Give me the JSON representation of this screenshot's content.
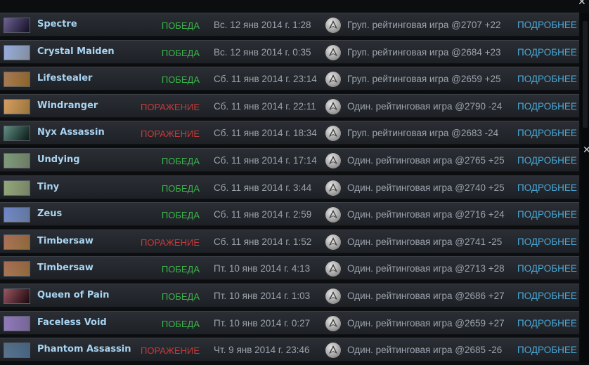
{
  "matches": [
    {
      "hero": "Spectre",
      "hero_colors": [
        "#3b2e6e",
        "#1d1638"
      ],
      "result": "ПОБЕДА",
      "result_type": "win",
      "date": "Вс. 12 янв 2014 г. 1:28",
      "mode": "Груп. рейтинговая игра @2707 +22",
      "details": "ПОДРОБНЕЕ"
    },
    {
      "hero": "Crystal Maiden",
      "hero_colors": [
        "#6f8fd6",
        "#c9d8ee"
      ],
      "result": "ПОБЕДА",
      "result_type": "win",
      "date": "Вс. 12 янв 2014 г. 0:35",
      "mode": "Груп. рейтинговая игра @2684 +23",
      "details": "ПОДРОБНЕЕ"
    },
    {
      "hero": "Lifestealer",
      "hero_colors": [
        "#8a4a1c",
        "#d39a3c"
      ],
      "result": "ПОБЕДА",
      "result_type": "win",
      "date": "Сб. 11 янв 2014 г. 23:14",
      "mode": "Груп. рейтинговая игра @2659 +25",
      "details": "ПОДРОБНЕЕ"
    },
    {
      "hero": "Windranger",
      "hero_colors": [
        "#c97a2c",
        "#e8b45c"
      ],
      "result": "ПОРАЖЕНИЕ",
      "result_type": "loss",
      "date": "Сб. 11 янв 2014 г. 22:11",
      "mode": "Один. рейтинговая игра @2790 -24",
      "details": "ПОДРОБНЕЕ"
    },
    {
      "hero": "Nyx Assassin",
      "hero_colors": [
        "#2b6a5a",
        "#0e2622"
      ],
      "result": "ПОРАЖЕНИЕ",
      "result_type": "loss",
      "date": "Сб. 11 янв 2014 г. 18:34",
      "mode": "Груп. рейтинговая игра @2683 -24",
      "details": "ПОДРОБНЕЕ"
    },
    {
      "hero": "Undying",
      "hero_colors": [
        "#4f7a4a",
        "#a7b99a"
      ],
      "result": "ПОБЕДА",
      "result_type": "win",
      "date": "Сб. 11 янв 2014 г. 17:14",
      "mode": "Один. рейтинговая игра @2765 +25",
      "details": "ПОДРОБНЕЕ"
    },
    {
      "hero": "Tiny",
      "hero_colors": [
        "#6c8a4a",
        "#b6c69a"
      ],
      "result": "ПОБЕДА",
      "result_type": "win",
      "date": "Сб. 11 янв 2014 г. 3:44",
      "mode": "Один. рейтинговая игра @2740 +25",
      "details": "ПОДРОБНЕЕ"
    },
    {
      "hero": "Zeus",
      "hero_colors": [
        "#3a5ab8",
        "#9ab8ea"
      ],
      "result": "ПОБЕДА",
      "result_type": "win",
      "date": "Сб. 11 янв 2014 г. 2:59",
      "mode": "Один. рейтинговая игра @2716 +24",
      "details": "ПОДРОБНЕЕ"
    },
    {
      "hero": "Timbersaw",
      "hero_colors": [
        "#8a3a1c",
        "#d9a25a"
      ],
      "result": "ПОРАЖЕНИЕ",
      "result_type": "loss",
      "date": "Сб. 11 янв 2014 г. 1:52",
      "mode": "Один. рейтинговая игра @2741 -25",
      "details": "ПОДРОБНЕЕ"
    },
    {
      "hero": "Timbersaw",
      "hero_colors": [
        "#8a3a1c",
        "#d9a25a"
      ],
      "result": "ПОБЕДА",
      "result_type": "win",
      "date": "Пт. 10 янв 2014 г. 4:13",
      "mode": "Один. рейтинговая игра @2713 +28",
      "details": "ПОДРОБНЕЕ"
    },
    {
      "hero": "Queen of Pain",
      "hero_colors": [
        "#7a1c2a",
        "#2a0a14"
      ],
      "result": "ПОБЕДА",
      "result_type": "win",
      "date": "Пт. 10 янв 2014 г. 1:03",
      "mode": "Один. рейтинговая игра @2686 +27",
      "details": "ПОДРОБНЕЕ"
    },
    {
      "hero": "Faceless Void",
      "hero_colors": [
        "#6a4aa8",
        "#b49ae0"
      ],
      "result": "ПОБЕДА",
      "result_type": "win",
      "date": "Пт. 10 янв 2014 г. 0:27",
      "mode": "Один. рейтинговая игра @2659 +27",
      "details": "ПОДРОБНЕЕ"
    },
    {
      "hero": "Phantom Assassin",
      "hero_colors": [
        "#1c3a5a",
        "#6a9ac8"
      ],
      "result": "ПОРАЖЕНИЕ",
      "result_type": "loss",
      "date": "Чт. 9 янв 2014 г. 23:46",
      "mode": "Один. рейтинговая игра @2685 -26",
      "details": "ПОДРОБНЕЕ"
    }
  ],
  "icons": {
    "close": "close-icon",
    "mode": "ranked-mode-icon"
  },
  "colors": {
    "win": "#3bb54a",
    "loss": "#c23b3b",
    "link": "#4aa9d8",
    "hero_name": "#a9d4f2"
  }
}
